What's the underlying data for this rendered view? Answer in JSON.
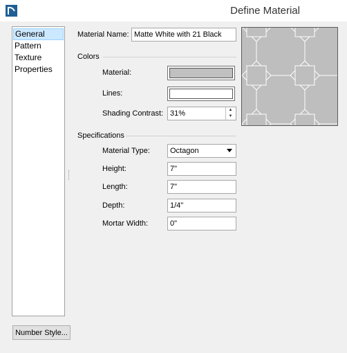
{
  "window": {
    "title": "Define Material",
    "icon": "chief-architect-logo-icon"
  },
  "nav": {
    "items": [
      {
        "label": "General",
        "selected": true
      },
      {
        "label": "Pattern",
        "selected": false
      },
      {
        "label": "Texture",
        "selected": false
      },
      {
        "label": "Properties",
        "selected": false
      }
    ]
  },
  "general": {
    "material_name_label": "Material Name:",
    "material_name_value": "Matte White with 21 Black"
  },
  "colors": {
    "title": "Colors",
    "material_label": "Material:",
    "material_color": "#c0c0c0",
    "lines_label": "Lines:",
    "lines_color": "#ffffff",
    "shading_label": "Shading Contrast:",
    "shading_value": "31%"
  },
  "specs": {
    "title": "Specifications",
    "type_label": "Material Type:",
    "type_value": "Octagon",
    "height_label": "Height:",
    "height_value": "7\"",
    "length_label": "Length:",
    "length_value": "7\"",
    "depth_label": "Depth:",
    "depth_value": "1/4\"",
    "mortar_label": "Mortar Width:",
    "mortar_value": "0\""
  },
  "footer": {
    "number_style_label": "Number Style..."
  },
  "preview": {
    "fill_color": "#bebebe",
    "line_color": "#ffffff",
    "pattern": "octagon"
  }
}
